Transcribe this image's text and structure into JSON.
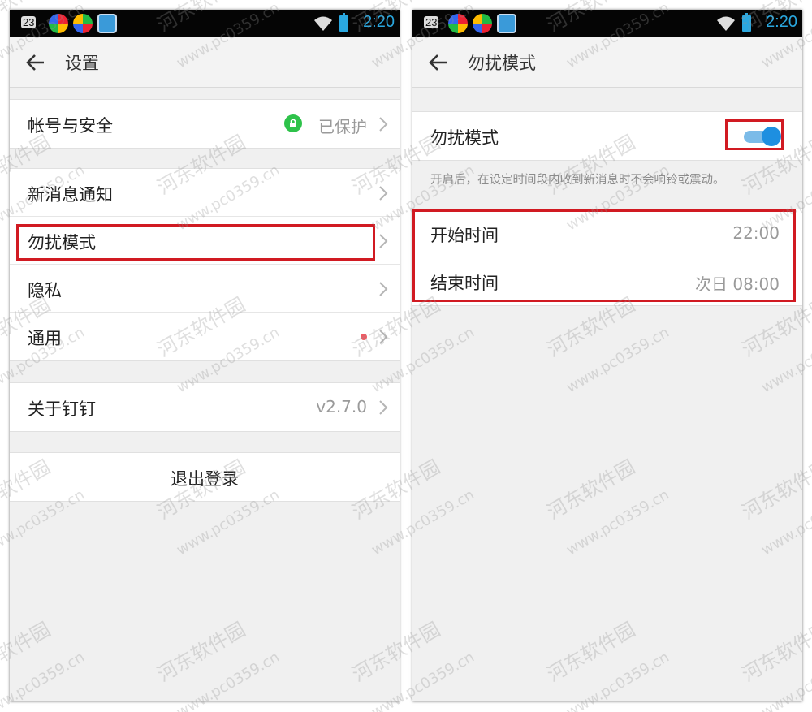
{
  "status_bar": {
    "notification_count": "23",
    "clock": "2:20",
    "icons": [
      "notification-badge-icon",
      "app-icon",
      "app-icon",
      "app-icon",
      "wifi-icon",
      "battery-icon"
    ]
  },
  "left_screen": {
    "title": "设置",
    "groups": [
      {
        "rows": [
          {
            "label": "帐号与安全",
            "value": "已保护",
            "icon": "lock-icon"
          }
        ]
      },
      {
        "rows": [
          {
            "label": "新消息通知"
          },
          {
            "label": "勿扰模式",
            "highlighted": true
          },
          {
            "label": "隐私"
          },
          {
            "label": "通用",
            "badge": "red-dot"
          }
        ]
      },
      {
        "rows": [
          {
            "label": "关于钉钉",
            "value": "v2.7.0"
          }
        ]
      }
    ],
    "logout_label": "退出登录"
  },
  "right_screen": {
    "title": "勿扰模式",
    "toggle_label": "勿扰模式",
    "toggle_on": true,
    "hint": "开启后，在设定时间段内收到新消息时不会响铃或震动。",
    "start_label": "开始时间",
    "start_value": "22:00",
    "end_label": "结束时间",
    "end_value": "次日 08:00"
  },
  "watermark": {
    "site_name": "河东软件园",
    "url": "www.pc0359.cn"
  },
  "colors": {
    "highlight": "#d11a22",
    "toggle": "#1e8fe0",
    "clock": "#2aa8e0",
    "lock": "#2ec24a",
    "badge": "#f05a63"
  }
}
